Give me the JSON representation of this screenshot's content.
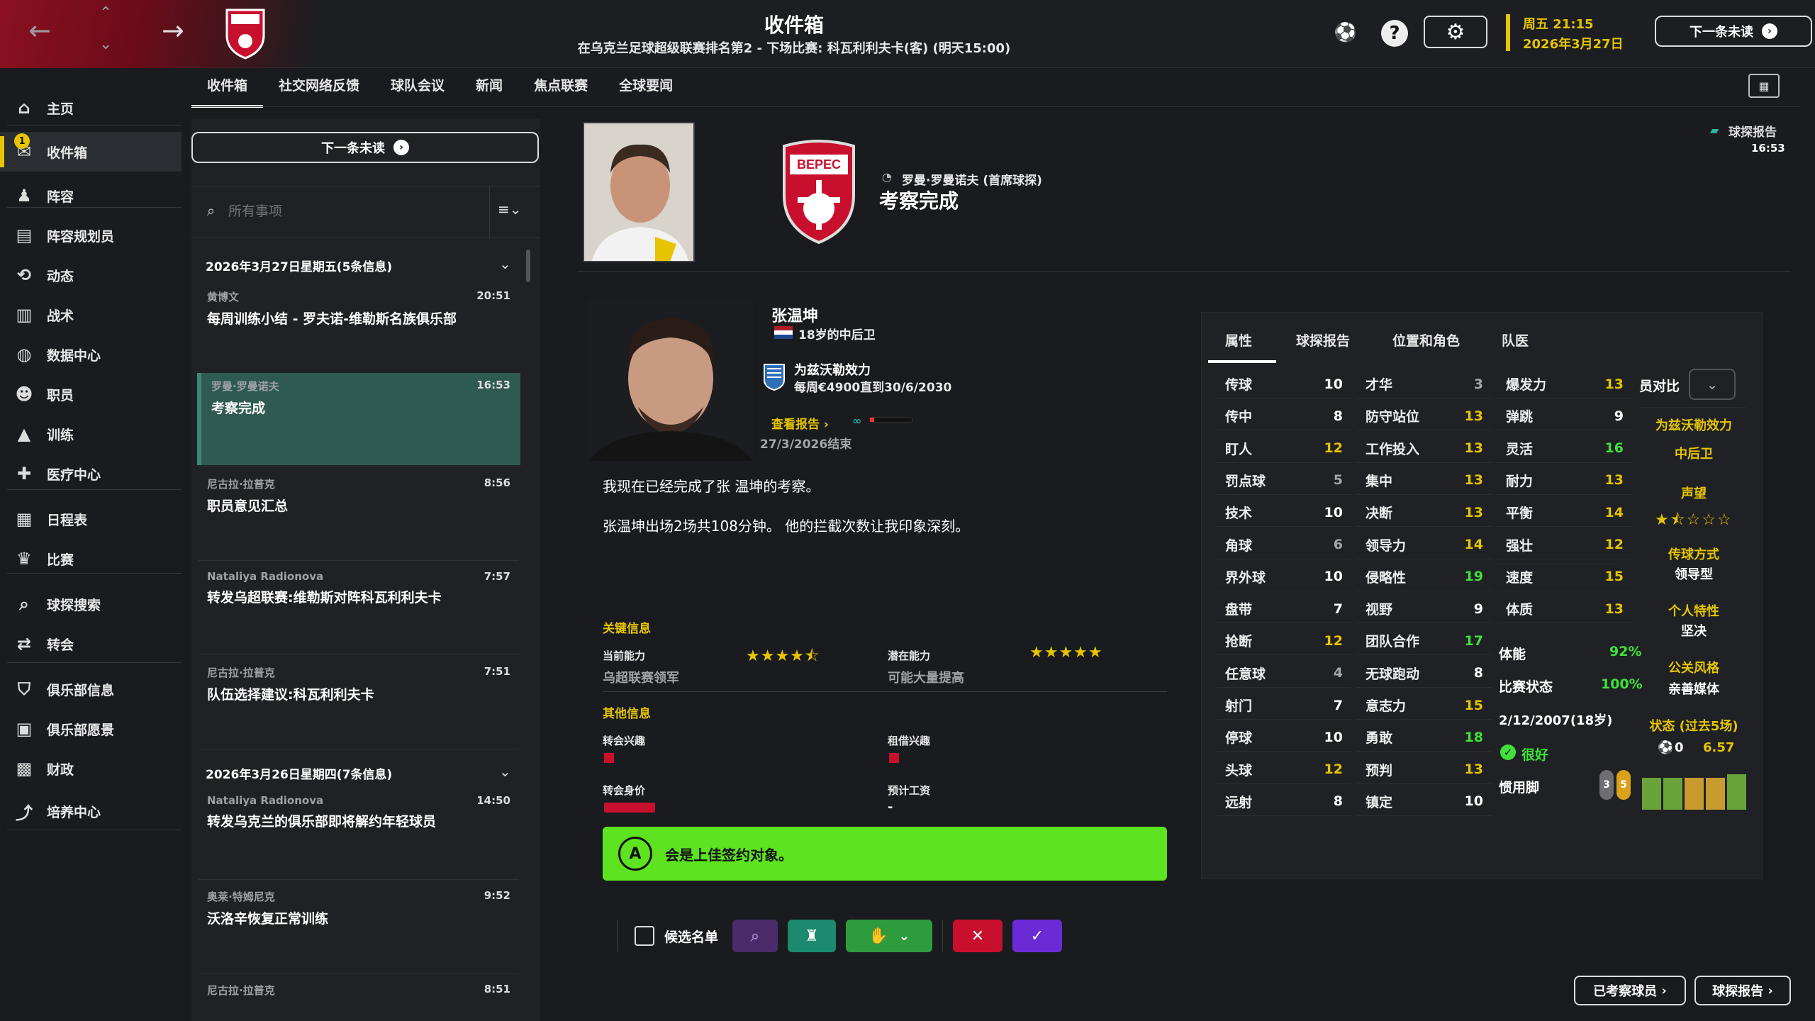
{
  "colors": {
    "accent": "#e6c500",
    "green": "#3fe23a",
    "verdict_bg": "#5de31f",
    "selected_msg": "#2f5a52"
  },
  "header": {
    "title": "收件箱",
    "subtitle": "在乌克兰足球超级联赛排名第2 - 下场比赛: 科瓦利利夫卡(客) (明天15:00)",
    "weekday_time": "周五 21:15",
    "date": "2026年3月27日",
    "next_unread": "下一条未读",
    "club_badge_text": "ВЕРЕС"
  },
  "sidebar": {
    "inbox_badge": "1",
    "items": [
      {
        "label": "主页",
        "icon": "home-icon"
      },
      {
        "label": "收件箱",
        "icon": "inbox-icon"
      },
      {
        "label": "阵容",
        "icon": "shirt-icon"
      },
      {
        "label": "阵容规划员",
        "icon": "clipboard-icon"
      },
      {
        "label": "动态",
        "icon": "dynamics-icon"
      },
      {
        "label": "战术",
        "icon": "tactics-icon"
      },
      {
        "label": "数据中心",
        "icon": "data-icon"
      },
      {
        "label": "职员",
        "icon": "staff-icon"
      },
      {
        "label": "训练",
        "icon": "training-icon"
      },
      {
        "label": "医疗中心",
        "icon": "medical-icon"
      },
      {
        "label": "日程表",
        "icon": "calendar-icon"
      },
      {
        "label": "比赛",
        "icon": "trophy-icon"
      },
      {
        "label": "球探搜索",
        "icon": "search-icon"
      },
      {
        "label": "转会",
        "icon": "transfer-icon"
      },
      {
        "label": "俱乐部信息",
        "icon": "shield-icon"
      },
      {
        "label": "俱乐部愿景",
        "icon": "vision-icon"
      },
      {
        "label": "财政",
        "icon": "finance-icon"
      },
      {
        "label": "培养中心",
        "icon": "development-icon"
      }
    ]
  },
  "tabs": [
    "收件箱",
    "社交网络反馈",
    "球队会议",
    "新闻",
    "焦点联赛",
    "全球要闻"
  ],
  "list": {
    "next_unread": "下一条未读",
    "search_placeholder": "所有事项",
    "group1": "2026年3月27日星期五(5条信息)",
    "group2": "2026年3月26日星期四(7条信息)",
    "messages": [
      {
        "from": "黄博文",
        "time": "20:51",
        "subject": "每周训练小结 - 罗夫诺-维勒斯名族俱乐部"
      },
      {
        "from": "罗曼·罗曼诺夫",
        "time": "16:53",
        "subject": "考察完成"
      },
      {
        "from": "尼古拉·拉普克",
        "time": "8:56",
        "subject": "职员意见汇总"
      },
      {
        "from": "Nataliya Radionova",
        "time": "7:57",
        "subject": "转发乌超联赛:维勒斯对阵科瓦利利夫卡"
      },
      {
        "from": "尼古拉·拉普克",
        "time": "7:51",
        "subject": "队伍选择建议:科瓦利利夫卡"
      },
      {
        "from": "Nataliya Radionova",
        "time": "14:50",
        "subject": "转发乌克兰的俱乐部即将解约年轻球员"
      },
      {
        "from": "奥莱·特姆尼克",
        "time": "9:52",
        "subject": "沃洛辛恢复正常训练"
      },
      {
        "from": "尼古拉·拉普克",
        "time": "8:51",
        "subject": ""
      }
    ]
  },
  "report": {
    "sender": "罗曼·罗曼诺夫 (首席球探)",
    "title": "考察完成",
    "corner_label": "球探报告",
    "corner_time": "16:53",
    "player_name": "张温坤",
    "player_age_pos": "18岁的中后卫",
    "contract_club": "为兹沃勒效力",
    "contract_detail": "每周€4900直到30/6/2030",
    "view_report": "查看报告",
    "end_date": "27/3/2026结束",
    "text1": "我现在已经完成了张 温坤的考察。",
    "text2": "张温坤出场2场共108分钟。 他的拦截次数让我印象深刻。",
    "key_info": "关键信息",
    "cur_ability_label": "当前能力",
    "cur_ability_stars": "★★★★⯪",
    "cur_ability_val": "乌超联赛领军",
    "pot_ability_label": "潜在能力",
    "pot_ability_stars": "★★★★★",
    "pot_ability_val": "可能大量提高",
    "other_info": "其他信息",
    "transfer_interest": "转会兴趣",
    "loan_interest": "租借兴趣",
    "transfer_value": "转会身价",
    "expected_wage": "预计工资",
    "expected_wage_val": "-",
    "verdict_grade": "A",
    "verdict_text": "会是上佳签约对象。"
  },
  "attr_tabs": [
    "属性",
    "球探报告",
    "位置和角色",
    "队医"
  ],
  "attributes": {
    "technical": [
      {
        "n": "传球",
        "v": "10",
        "c": "w"
      },
      {
        "n": "传中",
        "v": "8",
        "c": "w"
      },
      {
        "n": "盯人",
        "v": "12",
        "c": "y"
      },
      {
        "n": "罚点球",
        "v": "5",
        "c": "d"
      },
      {
        "n": "技术",
        "v": "10",
        "c": "w"
      },
      {
        "n": "角球",
        "v": "6",
        "c": "d"
      },
      {
        "n": "界外球",
        "v": "10",
        "c": "w"
      },
      {
        "n": "盘带",
        "v": "7",
        "c": "w"
      },
      {
        "n": "抢断",
        "v": "12",
        "c": "y"
      },
      {
        "n": "任意球",
        "v": "4",
        "c": "d"
      },
      {
        "n": "射门",
        "v": "7",
        "c": "w"
      },
      {
        "n": "停球",
        "v": "10",
        "c": "w"
      },
      {
        "n": "头球",
        "v": "12",
        "c": "y"
      },
      {
        "n": "远射",
        "v": "8",
        "c": "w"
      }
    ],
    "mental": [
      {
        "n": "才华",
        "v": "3",
        "c": "d"
      },
      {
        "n": "防守站位",
        "v": "13",
        "c": "y"
      },
      {
        "n": "工作投入",
        "v": "13",
        "c": "y"
      },
      {
        "n": "集中",
        "v": "13",
        "c": "y"
      },
      {
        "n": "决断",
        "v": "13",
        "c": "y"
      },
      {
        "n": "领导力",
        "v": "14",
        "c": "y"
      },
      {
        "n": "侵略性",
        "v": "19",
        "c": "g"
      },
      {
        "n": "视野",
        "v": "9",
        "c": "w"
      },
      {
        "n": "团队合作",
        "v": "17",
        "c": "g"
      },
      {
        "n": "无球跑动",
        "v": "8",
        "c": "w"
      },
      {
        "n": "意志力",
        "v": "15",
        "c": "y"
      },
      {
        "n": "勇敢",
        "v": "18",
        "c": "g"
      },
      {
        "n": "预判",
        "v": "13",
        "c": "y"
      },
      {
        "n": "镇定",
        "v": "10",
        "c": "w"
      }
    ],
    "physical": [
      {
        "n": "爆发力",
        "v": "13",
        "c": "y"
      },
      {
        "n": "弹跳",
        "v": "9",
        "c": "w"
      },
      {
        "n": "灵活",
        "v": "16",
        "c": "g"
      },
      {
        "n": "耐力",
        "v": "13",
        "c": "y"
      },
      {
        "n": "平衡",
        "v": "14",
        "c": "y"
      },
      {
        "n": "强壮",
        "v": "12",
        "c": "y"
      },
      {
        "n": "速度",
        "v": "15",
        "c": "y"
      },
      {
        "n": "体质",
        "v": "13",
        "c": "y"
      }
    ],
    "fitness_label": "体能",
    "fitness_val": "92%",
    "match_sharp_label": "比赛状态",
    "match_sharp_val": "100%",
    "dob": "2/12/2007(18岁)",
    "condition": "很好",
    "foot_label": "惯用脚",
    "foot_left": "3",
    "foot_right": "5",
    "compare_label": "员对比"
  },
  "right_info": {
    "club": "为兹沃勒效力",
    "position": "中后卫",
    "rep_label": "声望",
    "rep_stars": "★⯪☆☆☆",
    "pass_label": "传球方式",
    "pass_val": "领导型",
    "trait_label": "个人特性",
    "trait_val": "坚决",
    "media_label": "公关风格",
    "media_val": "亲善媒体",
    "form_label": "状态 (过去5场)",
    "form_goals": "0",
    "form_rating": "6.57",
    "form_bars": [
      0.9,
      0.9,
      0.9,
      0.9,
      1.0
    ]
  },
  "actions": {
    "shortlist": "候选名单"
  },
  "footer": {
    "scouted": "已考察球员",
    "report": "球探报告"
  }
}
